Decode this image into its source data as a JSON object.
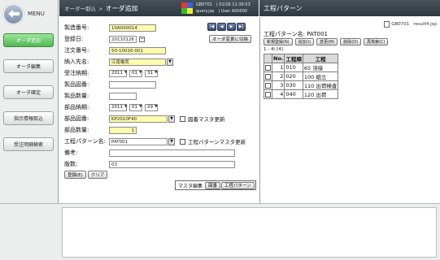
{
  "sidebar": {
    "menu_label": "MENU",
    "items": [
      {
        "label": "オーダ追加",
        "active": true
      },
      {
        "label": "オーダ編集",
        "active": false
      },
      {
        "label": "オーダ確定",
        "active": false
      },
      {
        "label": "指示情報取込",
        "active": false
      },
      {
        "label": "受注明細検索",
        "active": false
      }
    ]
  },
  "header": {
    "breadcrumb_parent": "オーダー取込",
    "breadcrumb_sep": ">",
    "title": "オーダ追加",
    "info_line1": "GB0701　| 01/26 11:30:53",
    "info_line2": "query.jsp　| User A00000"
  },
  "form": {
    "seizo_label": "製造番号:",
    "seizo_value": "10A000014",
    "toroku_label": "登録日:",
    "toroku_value": "20110126",
    "chumon_label": "注文番号:",
    "chumon_value": "50-10020-001",
    "nonyu_label": "納入先名:",
    "nonyu_value": "江南電気",
    "juchu_label": "受注納期:",
    "juchu_year": "2011",
    "juchu_month": "01",
    "juchu_day": "31",
    "seihin_zuban_label": "製品図番:",
    "seihin_zuban_value": "",
    "seihin_suryo_label": "製品数量:",
    "seihin_suryo_value": "",
    "buhin_noki_label": "部品納期:",
    "buhin_year": "2011",
    "buhin_month": "01",
    "buhin_day": "29",
    "buhin_zuban_label": "部品図番:",
    "buhin_zuban_value": "KP2010F40",
    "zuban_master_label": "図番マスタ更新",
    "buhin_suryo_label": "部品数量:",
    "buhin_suryo_value": "1",
    "koutei_label": "工程パターン名:",
    "koutei_value": "PAT001",
    "koutei_master_label": "工程パターンマスタ更新",
    "biko_label": "備考:",
    "biko_value": "",
    "hansu_label": "版数:",
    "hansu_value": "03",
    "mode_button": "オーダ変更に切換",
    "register_button": "登録(E)",
    "clear_button": "クリア",
    "master_edit_label": "マスタ編集",
    "zuban_button": "図番",
    "koutei_button": "工程パターン",
    "nav_first": "|◀",
    "nav_prev": "◀",
    "nav_next": "▶",
    "nav_last": "▶|"
  },
  "colors": {
    "swatch1": "#ee3333",
    "swatch2": "#3366dd",
    "swatch3": "#33bb33",
    "swatch4": "#eeee33",
    "active_green": "#52b752",
    "required_yellow": "#fffcae"
  },
  "right": {
    "title": "工程パターン",
    "screen_id": "GB0701",
    "page": "result4.jsp",
    "pattern_label": "工程パターン名:",
    "pattern_value": "PAT001",
    "buttons": [
      "新規登録(N)",
      "追加(I)",
      "変更(M)",
      "削除(D)",
      "再検索(C)"
    ],
    "pager": "1 - 4/ [4]",
    "columns": [
      "No.",
      "工程順",
      "工程"
    ],
    "rows": [
      {
        "no": "1",
        "order": "010",
        "process": "65 溶接"
      },
      {
        "no": "2",
        "order": "020",
        "process": "100 組立"
      },
      {
        "no": "3",
        "order": "030",
        "process": "110 出荷検査"
      },
      {
        "no": "4",
        "order": "040",
        "process": "120 出荷"
      }
    ]
  }
}
